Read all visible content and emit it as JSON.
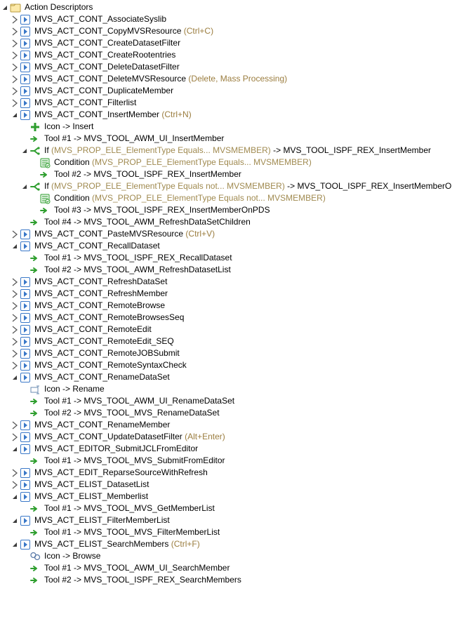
{
  "root": {
    "label": "Action Descriptors"
  },
  "items": {
    "a0": {
      "label": "MVS_ACT_CONT_AssociateSyslib"
    },
    "a1": {
      "label": "MVS_ACT_CONT_CopyMVSResource",
      "shortcut": "(Ctrl+C)"
    },
    "a2": {
      "label": "MVS_ACT_CONT_CreateDatasetFilter"
    },
    "a3": {
      "label": "MVS_ACT_CONT_CreateRootentries"
    },
    "a4": {
      "label": "MVS_ACT_CONT_DeleteDatasetFilter"
    },
    "a5": {
      "label": "MVS_ACT_CONT_DeleteMVSResource",
      "shortcut": "(Delete, Mass Processing)"
    },
    "a6": {
      "label": "MVS_ACT_CONT_DuplicateMember"
    },
    "a7": {
      "label": "MVS_ACT_CONT_Filterlist"
    },
    "a8": {
      "label": "MVS_ACT_CONT_InsertMember",
      "shortcut": "(Ctrl+N)"
    },
    "a8_icon": {
      "label": "Icon -> Insert"
    },
    "a8_t1": {
      "label": "Tool #1 -> MVS_TOOL_AWM_UI_InsertMember"
    },
    "a8_if1": {
      "prefix": "If ",
      "cond": "(MVS_PROP_ELE_ElementType Equals... MVSMEMBER)",
      "suffix": " -> MVS_TOOL_ISPF_REX_InsertMember"
    },
    "a8_if1_c": {
      "prefix": "Condition ",
      "cond": "(MVS_PROP_ELE_ElementType Equals... MVSMEMBER)"
    },
    "a8_if1_t": {
      "label": "Tool #2 -> MVS_TOOL_ISPF_REX_InsertMember"
    },
    "a8_if2": {
      "prefix": "If ",
      "cond": "(MVS_PROP_ELE_ElementType Equals not... MVSMEMBER)",
      "suffix": " -> MVS_TOOL_ISPF_REX_InsertMemberOnPDS"
    },
    "a8_if2_c": {
      "prefix": "Condition ",
      "cond": "(MVS_PROP_ELE_ElementType Equals not... MVSMEMBER)"
    },
    "a8_if2_t": {
      "label": "Tool #3 -> MVS_TOOL_ISPF_REX_InsertMemberOnPDS"
    },
    "a8_t4": {
      "label": "Tool #4 -> MVS_TOOL_AWM_RefreshDataSetChildren"
    },
    "a9": {
      "label": "MVS_ACT_CONT_PasteMVSResource",
      "shortcut": "(Ctrl+V)"
    },
    "a10": {
      "label": "MVS_ACT_CONT_RecallDataset"
    },
    "a10_t1": {
      "label": "Tool #1 -> MVS_TOOL_ISPF_REX_RecallDataset"
    },
    "a10_t2": {
      "label": "Tool #2 -> MVS_TOOL_AWM_RefreshDatasetList"
    },
    "a11": {
      "label": "MVS_ACT_CONT_RefreshDataSet"
    },
    "a12": {
      "label": "MVS_ACT_CONT_RefreshMember"
    },
    "a13": {
      "label": "MVS_ACT_CONT_RemoteBrowse"
    },
    "a14": {
      "label": "MVS_ACT_CONT_RemoteBrowsesSeq"
    },
    "a15": {
      "label": "MVS_ACT_CONT_RemoteEdit"
    },
    "a16": {
      "label": "MVS_ACT_CONT_RemoteEdit_SEQ"
    },
    "a17": {
      "label": "MVS_ACT_CONT_RemoteJOBSubmit"
    },
    "a18": {
      "label": "MVS_ACT_CONT_RemoteSyntaxCheck"
    },
    "a19": {
      "label": "MVS_ACT_CONT_RenameDataSet"
    },
    "a19_icon": {
      "label": "Icon -> Rename"
    },
    "a19_t1": {
      "label": "Tool #1 -> MVS_TOOL_AWM_UI_RenameDataSet"
    },
    "a19_t2": {
      "label": "Tool #2 -> MVS_TOOL_MVS_RenameDataSet"
    },
    "a20": {
      "label": "MVS_ACT_CONT_RenameMember"
    },
    "a21": {
      "label": "MVS_ACT_CONT_UpdateDatasetFilter",
      "shortcut": "(Alt+Enter)"
    },
    "a22": {
      "label": "MVS_ACT_EDITOR_SubmitJCLFromEditor"
    },
    "a22_t1": {
      "label": "Tool #1 -> MVS_TOOL_MVS_SubmitFromEditor"
    },
    "a23": {
      "label": "MVS_ACT_EDIT_ReparseSourceWithRefresh"
    },
    "a24": {
      "label": "MVS_ACT_ELIST_DatasetList"
    },
    "a25": {
      "label": "MVS_ACT_ELIST_Memberlist"
    },
    "a25_t1": {
      "label": "Tool #1 -> MVS_TOOL_MVS_GetMemberList"
    },
    "a26": {
      "label": "MVS_ACT_ELIST_FilterMemberList"
    },
    "a26_t1": {
      "label": "Tool #1 -> MVS_TOOL_MVS_FilterMemberList"
    },
    "a27": {
      "label": "MVS_ACT_ELIST_SearchMembers",
      "shortcut": "(Ctrl+F)"
    },
    "a27_icon": {
      "label": "Icon -> Browse"
    },
    "a27_t1": {
      "label": "Tool #1 -> MVS_TOOL_AWM_UI_SearchMember"
    },
    "a27_t2": {
      "label": "Tool #2 -> MVS_TOOL_ISPF_REX_SearchMembers"
    }
  }
}
